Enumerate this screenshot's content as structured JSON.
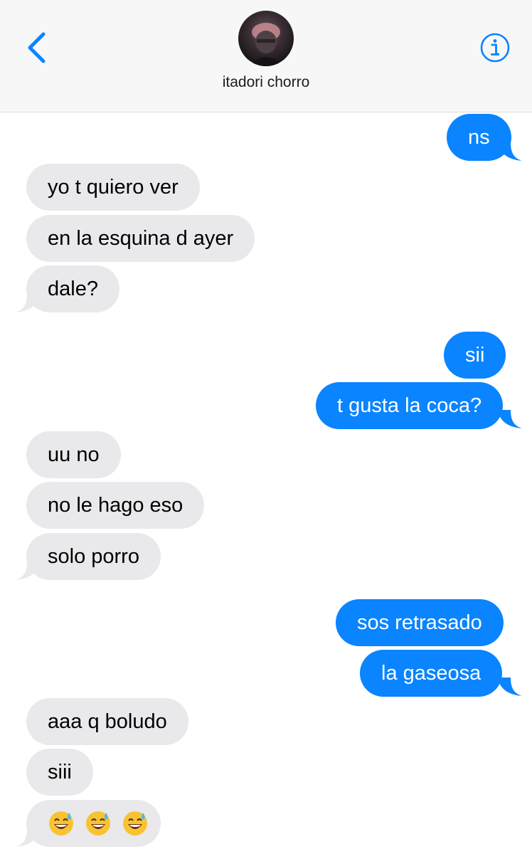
{
  "header": {
    "contact_name": "itadori chorro",
    "back_icon": "chevron-left-icon",
    "info_icon": "info-circle-icon",
    "accent_color": "#0a84ff"
  },
  "messages": [
    {
      "direction": "outgoing",
      "text": "ns"
    },
    {
      "direction": "incoming",
      "text": "yo t quiero ver"
    },
    {
      "direction": "incoming",
      "text": "en la esquina d ayer"
    },
    {
      "direction": "incoming",
      "text": "dale?"
    },
    {
      "direction": "outgoing",
      "text": "sii"
    },
    {
      "direction": "outgoing",
      "text": "t gusta la coca?"
    },
    {
      "direction": "incoming",
      "text": "uu no"
    },
    {
      "direction": "incoming",
      "text": "no le hago eso"
    },
    {
      "direction": "incoming",
      "text": "solo porro"
    },
    {
      "direction": "outgoing",
      "text": "sos retrasado"
    },
    {
      "direction": "outgoing",
      "text": "la gaseosa"
    },
    {
      "direction": "incoming",
      "text": "aaa q boludo"
    },
    {
      "direction": "incoming",
      "text": "siii"
    },
    {
      "direction": "incoming",
      "text": "😅😅😅",
      "emoji": "grinning-sweat-face-icon"
    }
  ],
  "colors": {
    "incoming_bubble": "#e9e9eb",
    "outgoing_bubble": "#0a84ff",
    "header_bg": "#f7f7f8"
  }
}
